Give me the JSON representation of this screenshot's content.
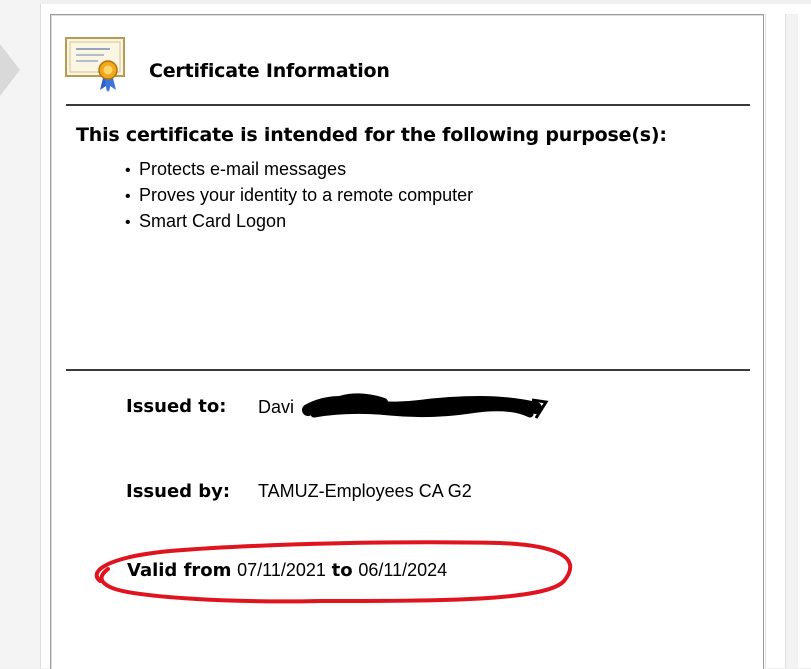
{
  "header": {
    "title": "Certificate Information"
  },
  "purposes": {
    "heading": "This certificate is intended for the following purpose(s):",
    "bullet": "•",
    "items": [
      "Protects e-mail messages",
      "Proves your identity to a remote computer",
      "Smart Card Logon"
    ]
  },
  "issued_to": {
    "label": "Issued to:",
    "value": "Davi"
  },
  "issued_by": {
    "label": "Issued by:",
    "value": "TAMUZ-Employees CA G2"
  },
  "validity": {
    "from_label": "Valid from",
    "from_value": "07/11/2021",
    "to_label": "to",
    "to_value": "06/11/2024"
  },
  "annotation_color": "#e0141e",
  "icon": "certificate-icon"
}
